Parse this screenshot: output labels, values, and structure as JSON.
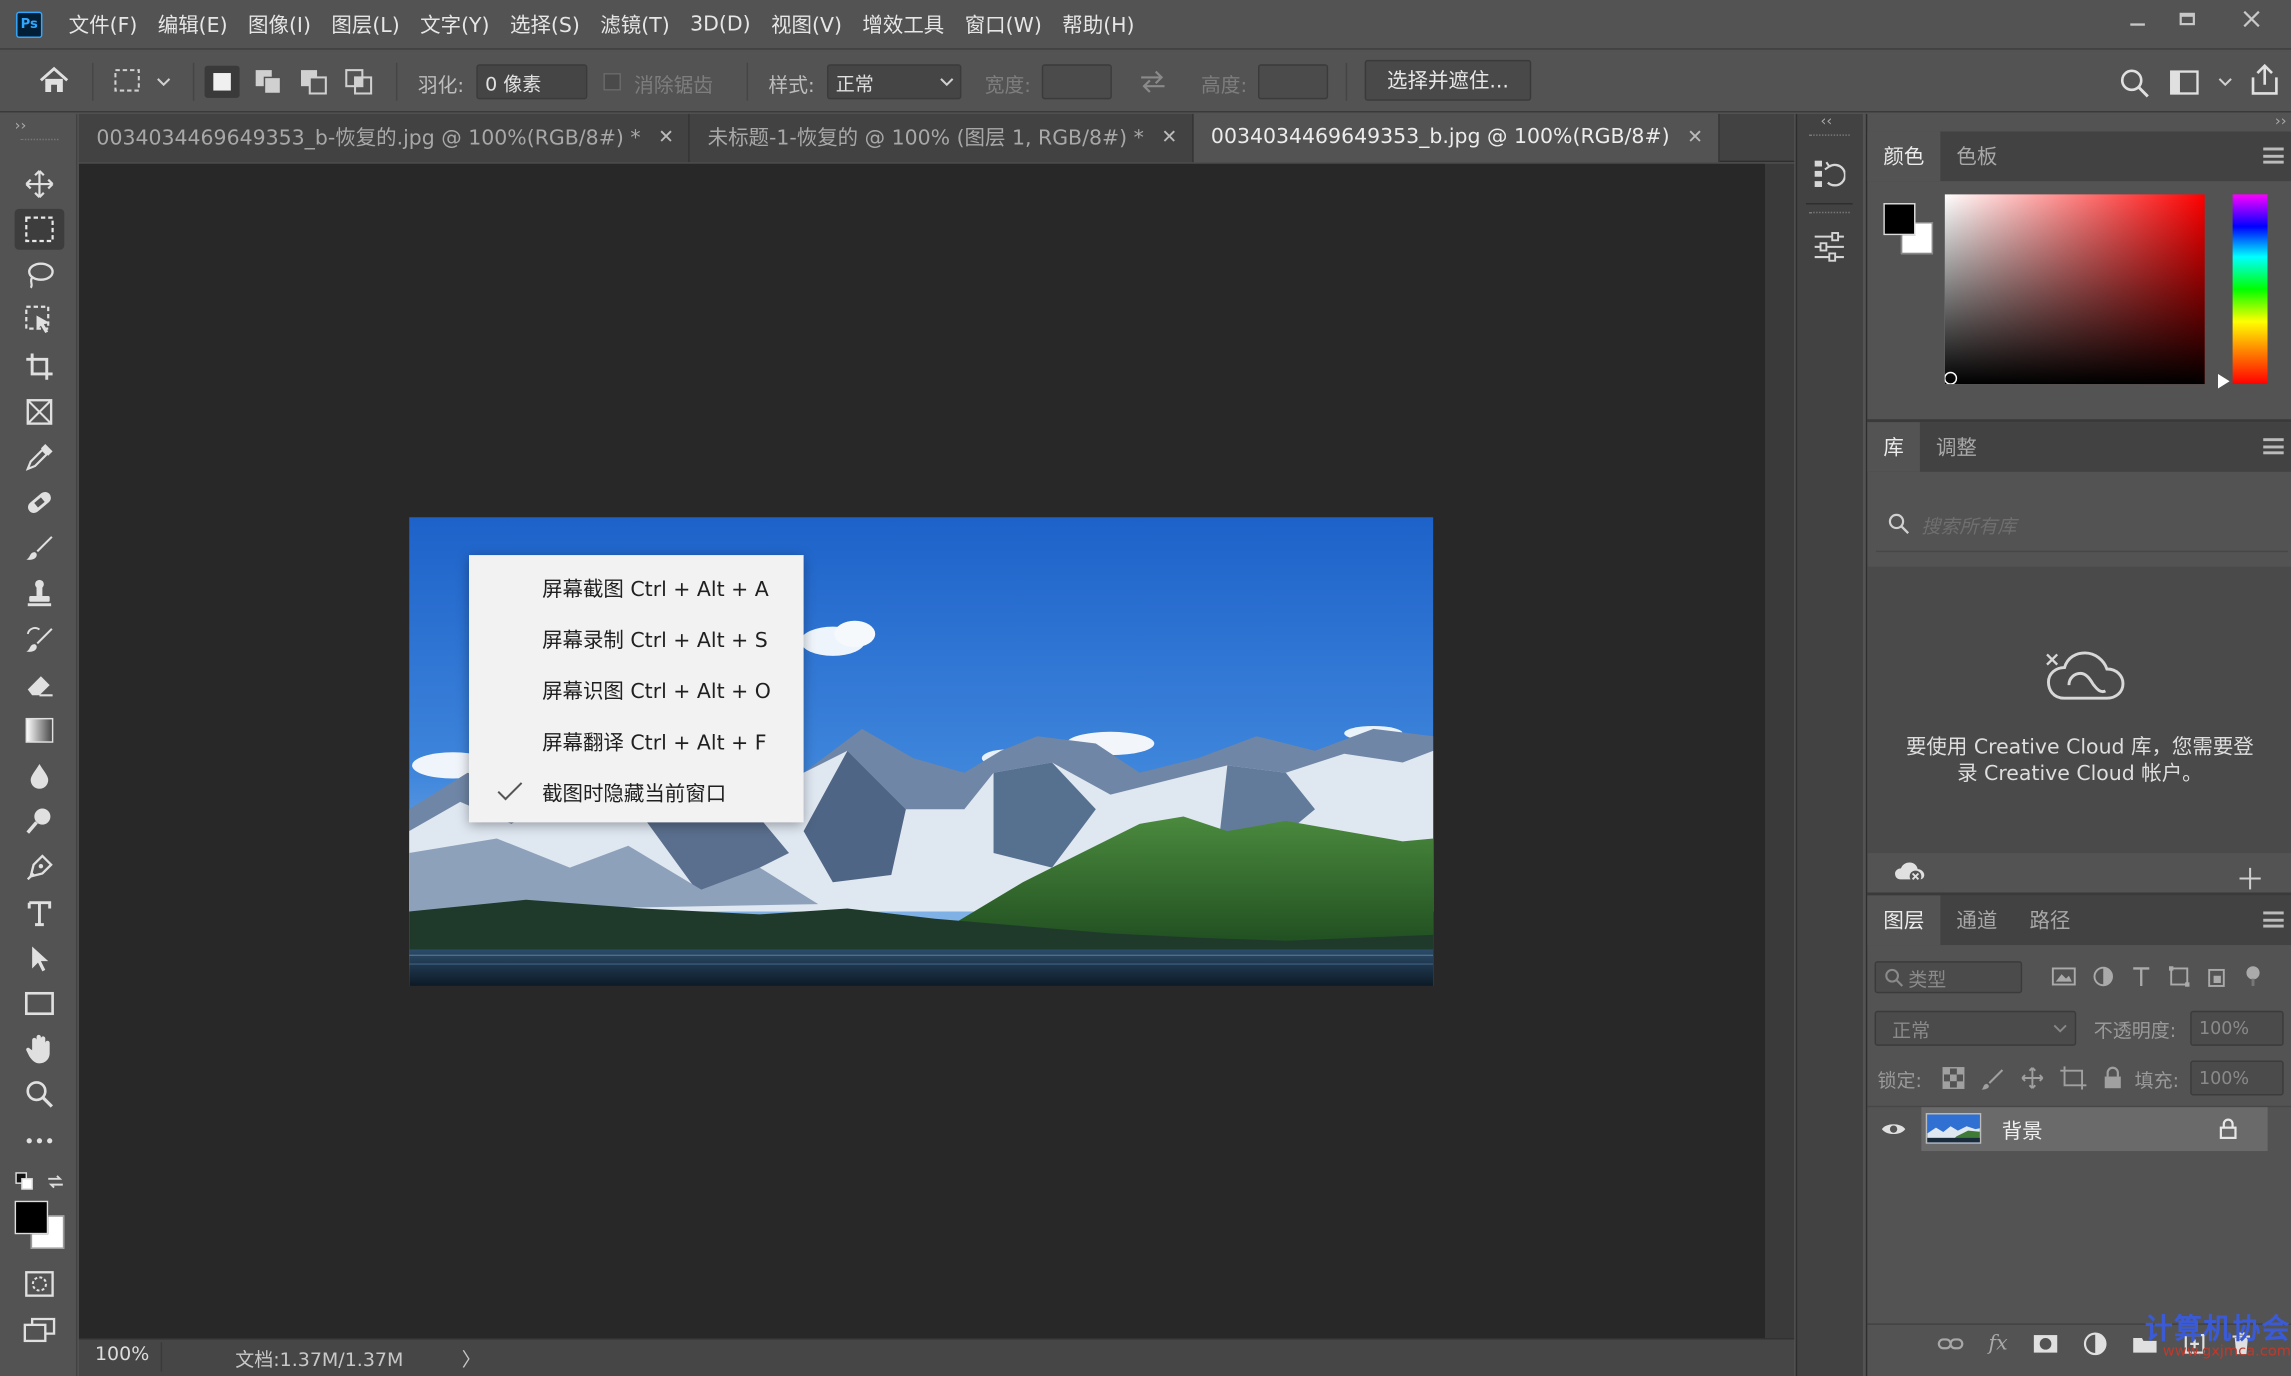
{
  "app": {
    "logo": "Ps"
  },
  "menu": {
    "items": [
      "文件(F)",
      "编辑(E)",
      "图像(I)",
      "图层(L)",
      "文字(Y)",
      "选择(S)",
      "滤镜(T)",
      "3D(D)",
      "视图(V)",
      "增效工具",
      "窗口(W)",
      "帮助(H)"
    ]
  },
  "options": {
    "feather_label": "羽化:",
    "feather_value": "0 像素",
    "antialias_label": "消除锯齿",
    "style_label": "样式:",
    "style_value": "正常",
    "width_label": "宽度:",
    "height_label": "高度:",
    "select_mask_button": "选择并遮住..."
  },
  "tabs": [
    {
      "label": "0034034469649353_b-恢复的.jpg @ 100%(RGB/8#) *",
      "active": false
    },
    {
      "label": "未标题-1-恢复的 @ 100% (图层 1, RGB/8#) *",
      "active": false
    },
    {
      "label": "0034034469649353_b.jpg @ 100%(RGB/8#)",
      "active": true
    }
  ],
  "context_menu": {
    "items": [
      {
        "label": "屏幕截图 Ctrl + Alt + A",
        "checked": false
      },
      {
        "label": "屏幕录制 Ctrl + Alt + S",
        "checked": false
      },
      {
        "label": "屏幕识图 Ctrl + Alt + O",
        "checked": false
      },
      {
        "label": "屏幕翻译 Ctrl + Alt + F",
        "checked": false
      },
      {
        "label": "截图时隐藏当前窗口",
        "checked": true
      }
    ]
  },
  "status": {
    "zoom": "100%",
    "doc": "文档:1.37M/1.37M",
    "arrow": "〉"
  },
  "color_panel": {
    "tabs": [
      "颜色",
      "色板"
    ],
    "foreground": "#000000",
    "background": "#ffffff",
    "hue": "#ff0000"
  },
  "library_panel": {
    "tabs": [
      "库",
      "调整"
    ],
    "search_placeholder": "搜索所有库",
    "message_line1": "要使用 Creative Cloud 库，您需要登",
    "message_line2": "录 Creative Cloud 帐户。"
  },
  "layers_panel": {
    "tabs": [
      "图层",
      "通道",
      "路径"
    ],
    "filter_label": "类型",
    "blend_mode": "正常",
    "opacity_label": "不透明度:",
    "opacity_value": "100%",
    "lock_label": "锁定:",
    "fill_label": "填充:",
    "fill_value": "100%",
    "layers": [
      {
        "name": "背景",
        "visible": true,
        "locked": true
      }
    ]
  },
  "watermark": {
    "line1": "计算机协会",
    "line2": "www.gxjmca.com"
  }
}
